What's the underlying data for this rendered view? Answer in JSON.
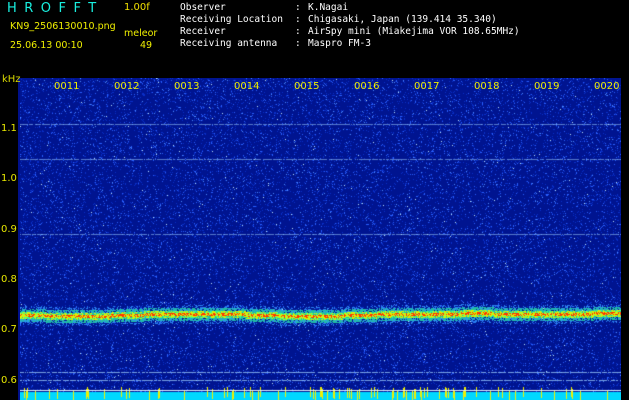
{
  "app": {
    "title": "HROFFT",
    "version": "1.00f"
  },
  "image": {
    "filename": "KN9_2506130010.png",
    "mode": "meleor",
    "timestamp": "25.06.13 00:10",
    "count": "49"
  },
  "station": {
    "rows": [
      {
        "label": "Observer",
        "value": "K.Nagai"
      },
      {
        "label": "Receiving Location",
        "value": "Chigasaki, Japan (139.414 35.340)"
      },
      {
        "label": "Receiver",
        "value": "AirSpy mini (Miakejima VOR 108.65MHz)"
      },
      {
        "label": "Receiving antenna",
        "value": "Maspro FM-3"
      }
    ]
  },
  "axes": {
    "y_unit": "kHz",
    "y_ticks": [
      "1.1",
      "1.0",
      "0.9",
      "0.8",
      "0.7",
      "0.6"
    ],
    "x_ticks": [
      "0011",
      "0012",
      "0013",
      "0014",
      "0015",
      "0016",
      "0017",
      "0018",
      "0019",
      "0020"
    ]
  },
  "spectrogram": {
    "background": "#001490",
    "noise_color": "#2a60ff",
    "carrier_freq_khz": 0.73,
    "carrier_colors": [
      "#20c0a0",
      "#e0f000",
      "#ff3000"
    ],
    "steady_lines_khz": [
      1.11,
      1.04,
      0.89,
      0.615,
      0.6
    ],
    "floor_color": "#00d8ff"
  }
}
